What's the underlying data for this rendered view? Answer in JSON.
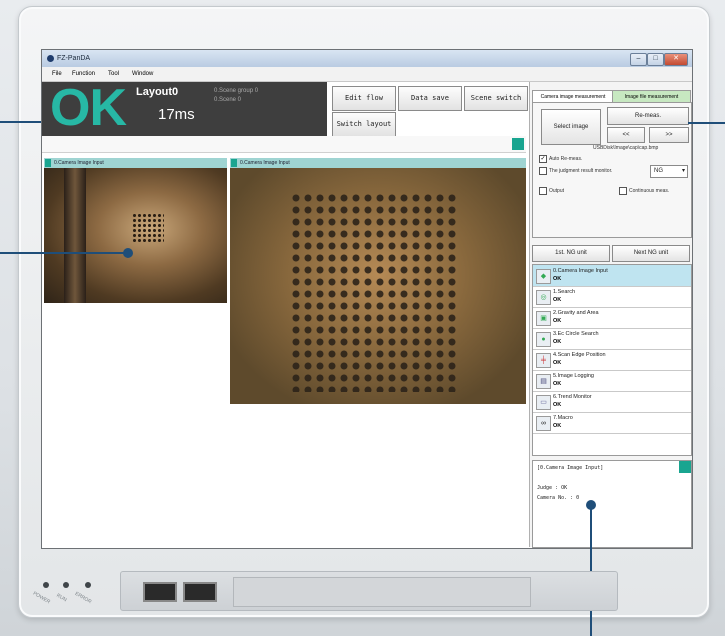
{
  "window": {
    "title": "FZ-PanDA",
    "buttons": [
      "–",
      "□",
      "✕"
    ]
  },
  "menu": [
    "File",
    "Function",
    "Tool",
    "Window"
  ],
  "judge": {
    "result": "OK",
    "layout": "Layout0",
    "time": "17ms",
    "scene_group": "0.Scene group 0",
    "scene": "0.Scene 0"
  },
  "toolbar": [
    "Edit flow",
    "Data save",
    "Scene switch",
    "Switch layout"
  ],
  "image_windows": [
    {
      "title": "0.Camera Image Input"
    },
    {
      "title": "0.Camera Image Input"
    }
  ],
  "right_panel": {
    "tabs": [
      "Camera image measurement",
      "Image file measurement"
    ],
    "select_image": "Select image",
    "remeas": "Re-meas.",
    "prev": "<<",
    "next": ">>",
    "file_path": "USBDisk\\Image\\cap\\cap.bmp",
    "auto_remeas": "Auto Re-meas.",
    "judgment_monitor": "The judgment result monitor.",
    "judgment_value": "NG",
    "output": "Output",
    "continuous": "Continuous meas.",
    "first_ng": "1st. NG unit",
    "next_ng": "Next NG unit"
  },
  "flow": [
    {
      "name": "0.Camera Image Input",
      "result": "OK",
      "icon": "camera-icon"
    },
    {
      "name": "1.Search",
      "result": "OK",
      "icon": "search-icon"
    },
    {
      "name": "2.Gravity and Area",
      "result": "OK",
      "icon": "area-icon"
    },
    {
      "name": "3.Ec Circle Search",
      "result": "OK",
      "icon": "circle-icon"
    },
    {
      "name": "4.Scan Edge Position",
      "result": "OK",
      "icon": "edge-icon"
    },
    {
      "name": "5.Image Logging",
      "result": "OK",
      "icon": "log-icon"
    },
    {
      "name": "6.Trend Monitor",
      "result": "OK",
      "icon": "trend-icon"
    },
    {
      "name": "7.Macro",
      "result": "OK",
      "icon": "macro-icon"
    }
  ],
  "detail": {
    "header": "[0.Camera Image Input]",
    "judge": "Judge : OK",
    "camera": "Camera No. : 0"
  },
  "hardware": {
    "leds": [
      "POWER",
      "RUN",
      "ERROR"
    ]
  }
}
